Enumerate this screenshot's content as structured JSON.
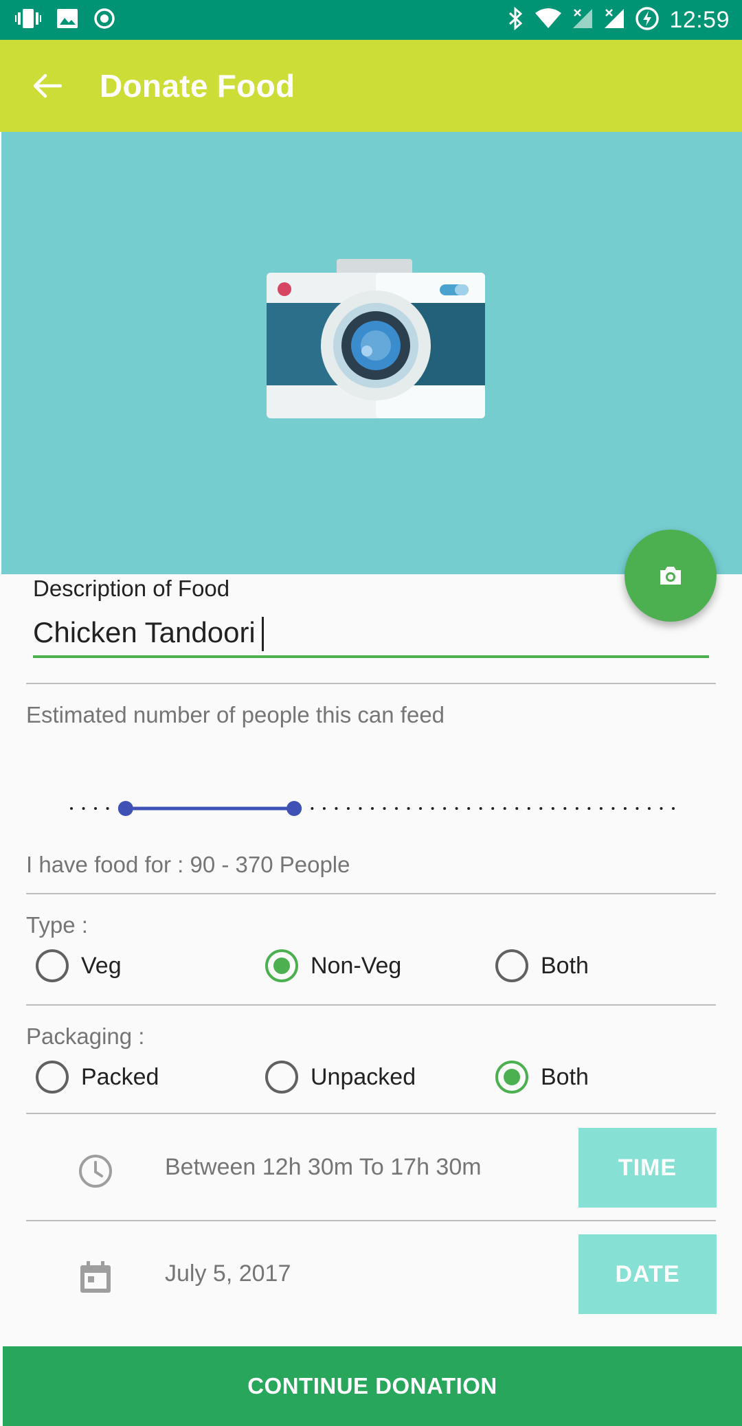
{
  "status_bar": {
    "time": "12:59",
    "left_icons": [
      "vibrate-icon",
      "image-icon",
      "record-icon"
    ],
    "right_icons": [
      "bluetooth-icon",
      "wifi-icon",
      "signal-x-icon",
      "signal-x-icon",
      "battery-charging-icon"
    ]
  },
  "app_bar": {
    "title": "Donate Food",
    "back_icon": "arrow-back-icon"
  },
  "hero": {
    "image_icon": "camera-illustration",
    "fab_icon": "camera-icon"
  },
  "description": {
    "label": "Description of Food",
    "value": "Chicken Tandoori"
  },
  "people": {
    "label": "Estimated number of people this can feed",
    "range_min": 0,
    "range_max": 1000,
    "selected_low": 90,
    "selected_high": 370,
    "summary": "I have food for : 90 - 370 People"
  },
  "type": {
    "label": "Type :",
    "options": [
      {
        "label": "Veg",
        "checked": false
      },
      {
        "label": "Non-Veg",
        "checked": true
      },
      {
        "label": "Both",
        "checked": false
      }
    ]
  },
  "packaging": {
    "label": "Packaging :",
    "options": [
      {
        "label": "Packed",
        "checked": false
      },
      {
        "label": "Unpacked",
        "checked": false
      },
      {
        "label": "Both",
        "checked": true
      }
    ]
  },
  "time_row": {
    "icon": "clock-icon",
    "text": "Between 12h 30m  To 17h 30m",
    "button": "TIME"
  },
  "date_row": {
    "icon": "calendar-icon",
    "text": "July 5, 2017",
    "button": "DATE"
  },
  "continue_label": "CONTINUE DONATION",
  "colors": {
    "status_bar": "#009474",
    "app_bar": "#cddd38",
    "hero_bg": "#75cdcf",
    "accent": "#4caf50",
    "slider": "#3f51b5",
    "pick_button": "#86e1d4",
    "cta": "#28a65b"
  }
}
